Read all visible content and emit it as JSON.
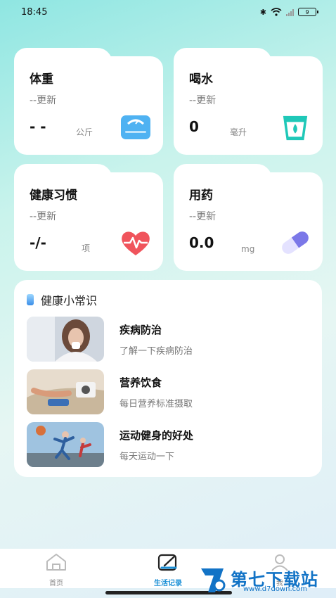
{
  "status_bar": {
    "time": "18:45",
    "battery": "9"
  },
  "cards": [
    {
      "id": "weight",
      "title": "体重",
      "updated": "--更新",
      "value": "- -",
      "unit": "公斤",
      "icon": "scale-icon"
    },
    {
      "id": "water",
      "title": "喝水",
      "updated": "--更新",
      "value": "0",
      "unit": "毫升",
      "icon": "water-cup-icon"
    },
    {
      "id": "habit",
      "title": "健康习惯",
      "updated": "--更新",
      "value": "-/-",
      "unit": "项",
      "icon": "heart-pulse-icon"
    },
    {
      "id": "medicine",
      "title": "用药",
      "updated": "--更新",
      "value": "0.0",
      "unit": "mg",
      "icon": "pill-icon"
    }
  ],
  "knowledge": {
    "title": "健康小常识",
    "items": [
      {
        "title": "疾病防治",
        "desc": "了解一下疾病防治"
      },
      {
        "title": "营养饮食",
        "desc": "每日营养标准摄取"
      },
      {
        "title": "运动健身的好处",
        "desc": "每天运动一下"
      }
    ]
  },
  "tabbar": {
    "home": "首页",
    "records": "生活记录",
    "mine": "我"
  },
  "watermark": {
    "text": "第七下载站",
    "url": "www.d7down.com"
  },
  "colors": {
    "accent": "#1a8fd6",
    "water": "#1fc8b8",
    "heart": "#f0545c",
    "pill": "#7b78e8"
  }
}
